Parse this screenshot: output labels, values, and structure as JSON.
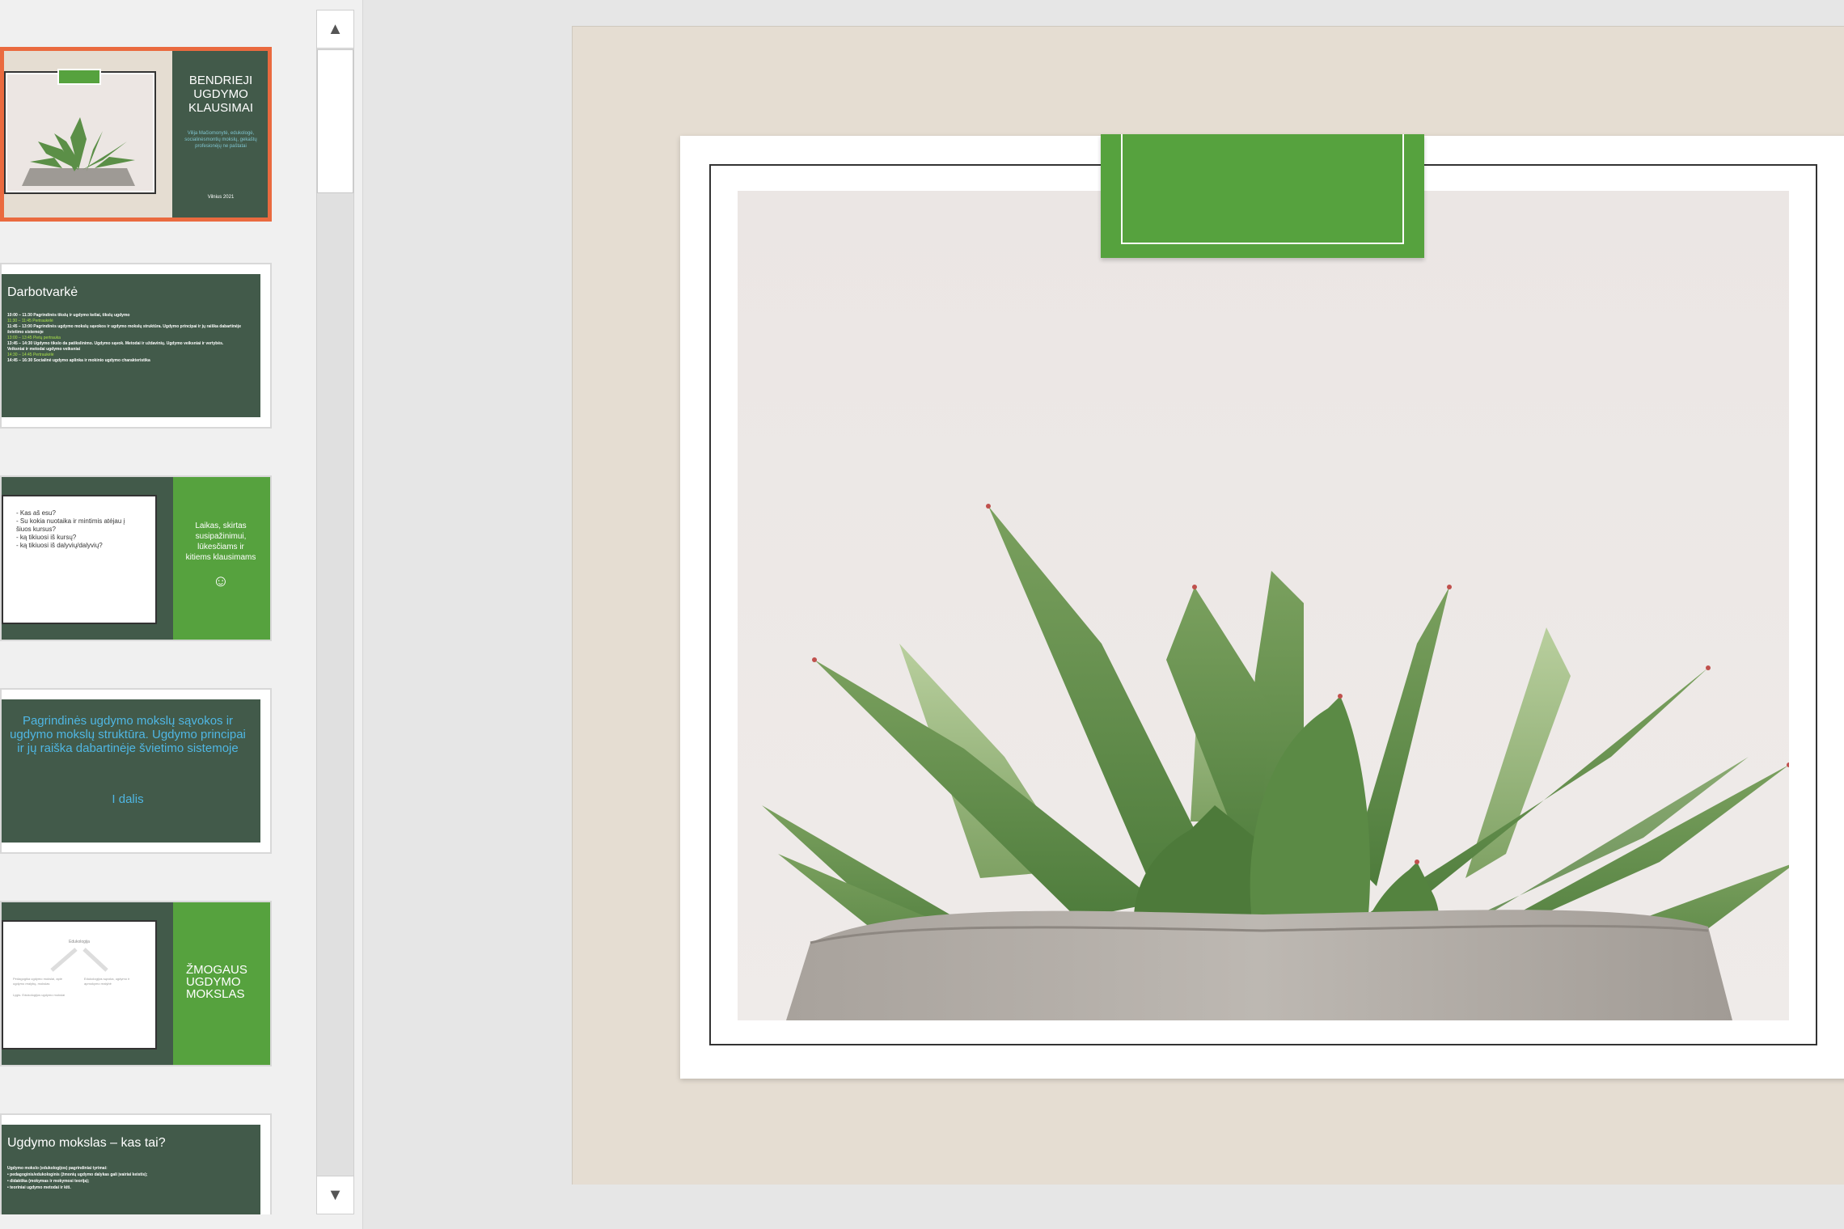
{
  "slides": [
    {
      "title": "BENDRIEJI UGDYMO KLAUSIMAI",
      "subtitle": "Vilija Mačiomonytė, edukologė, socialinėsmontių mokslų, gekaštų profesionėjų ne paštatai",
      "footer": "Vilnius 2021"
    },
    {
      "title": "Darbotvarkė",
      "bullets": [
        "10:00 – 11:30 Pagrindinės tikslų ir ugdymo keliai, tikslų ugdymo",
        "11:30 – 11:45 Pertraukėlė",
        "11:45 – 13:00 Pagrindinės ugdymo mokslų sąvokos ir ugdymo mokslų struktūra. Ugdymo principai ir jų raiška dabartinėje švietimo sistemoje",
        "13:00 – 13:45 Pietų pertrauka",
        "13:45 – 14:30 Ugdymo tikslo da patikslinimo. Ugdymo sąvok. Metodai ir uždavinių. Ugdymo veiksniai ir vertybės. Veiksniai ir metodai ugdymo veiksniai",
        "14:30 – 14:45 Pertraukėlė",
        "14:45 – 16:30 Socialinė ugdymo aplinka ir mokinio ugdymo charakteristika"
      ]
    },
    {
      "bullets": [
        "- Kas aš esu?",
        "- Su kokia nuotaika ir mintimis atėjau į šiuos kursus?",
        "- ką tikiuosi iš kursų?",
        "- ką tikiuosi iš dalyvių/dalyvių?"
      ],
      "side_text": "Laikas, skirtas susipažinimui, lūkesčiams ir kitiems klausimams",
      "emoji": "☺"
    },
    {
      "title": "Pagrindinės ugdymo mokslų sąvokos ir ugdymo mokslų struktūra. Ugdymo principai ir jų raiška dabartinėje švietimo sistemoje",
      "subtitle": "I dalis"
    },
    {
      "side_title": "ŽMOGAUS UGDYMO MOKSLAS",
      "diagram_top": "Edukologija",
      "diagram_left": "Pedagogika ugdymo mokslai, apie ugdymo realybę, mokslas",
      "diagram_right": "Edukologijos sąvoka, ugdymo ir apmokymo realybė",
      "diagram_note": "Lygis. Edukologijos ugdymo mokslai"
    },
    {
      "title": "Ugdymo mokslas – kas tai?",
      "bullets": [
        "Ugdymo mokslo (edukologijos) pagrindiniai tyrimai:",
        "• pedagoginis/edukologinis (žmonių ugdymo dalykas gali įvairiai keistis);",
        "• didaktika (mokymas ir mokymosi teorija);",
        "• teoriniai ugdymo metodai ir kiti."
      ]
    }
  ],
  "scrollbar": {
    "up_arrow": "▲",
    "down_arrow": "▼"
  },
  "colors": {
    "dark_slide": "#425a4a",
    "green_accent": "#56a23e",
    "selection": "#ea6a3f",
    "slide_bg": "#e5ddd2"
  }
}
